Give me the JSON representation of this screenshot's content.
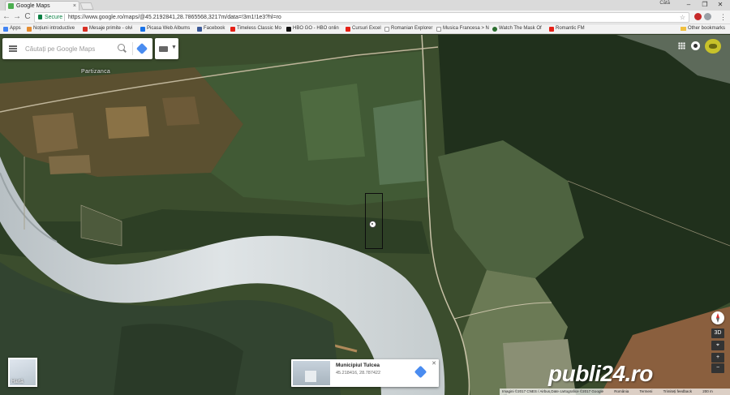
{
  "browser": {
    "tab_title": "Google Maps",
    "tab_close": "×",
    "user": "Cătă",
    "window_controls": [
      "–",
      "❐",
      "✕"
    ],
    "nav": {
      "back": "←",
      "forward": "→",
      "reload": "C"
    },
    "address": {
      "secure_label": "Secure",
      "url": "https://www.google.ro/maps/@45.2192841,28.7865568,3217m/data=!3m1!1e3?hl=ro"
    },
    "menu": "⋮"
  },
  "bookmarks": {
    "items": [
      {
        "label": "Apps",
        "color": "#4285f4"
      },
      {
        "label": "Noțiuni introductive",
        "color": "#e58c2f"
      },
      {
        "label": "Mesaje primite - olvi",
        "color": "#d93025"
      },
      {
        "label": "Picasa Web Albums",
        "color": "#1a73e8"
      },
      {
        "label": "Facebook",
        "color": "#3b5998"
      },
      {
        "label": "Timeless Classic Mo",
        "color": "#e62117"
      },
      {
        "label": "HBO GO - HBO onlin",
        "color": "#111111"
      },
      {
        "label": "Cursuri Excel",
        "color": "#e62117"
      },
      {
        "label": "Romanian Explorer",
        "color": "#8a8a8a"
      },
      {
        "label": "Musica Francesa > N",
        "color": "#8a8a8a"
      },
      {
        "label": "Watch The Mask Of",
        "color": "#2c6e2f"
      },
      {
        "label": "Romantic FM",
        "color": "#e62117"
      }
    ],
    "other": "Other bookmarks"
  },
  "map": {
    "search_placeholder": "Căutați pe Google Maps",
    "place_label": "Partizanca",
    "earth_toggle_label": "Hartă",
    "controls": {
      "three_d": "3D",
      "locate": "⌖",
      "zoom_in": "+",
      "zoom_out": "−"
    },
    "info_card": {
      "title": "Municipiul Tulcea",
      "coords": "45.218416, 28.787422",
      "close": "✕"
    },
    "watermark": "publi24.ro",
    "footer": [
      "Imagini ©2017 CNES / Airbus,Date cartografice ©2017 Google",
      "România",
      "Termeni",
      "Trimiteți feedback",
      "200 m"
    ]
  }
}
